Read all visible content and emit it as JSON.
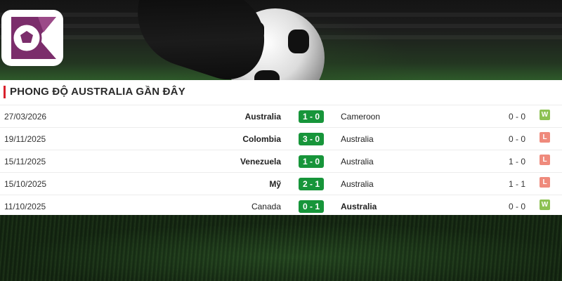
{
  "header": {
    "title": "PHONG ĐỘ AUSTRALIA GẦN ĐÂY"
  },
  "colors": {
    "score_bg": "#17953a",
    "win": "#8cc152",
    "loss": "#ef8a7c",
    "accent": "#d9212c"
  },
  "matches": [
    {
      "date": "27/03/2026",
      "home": "Australia",
      "score": "1 - 0",
      "away": "Cameroon",
      "half_time": "0 - 0",
      "result": "W"
    },
    {
      "date": "19/11/2025",
      "home": "Colombia",
      "score": "3 - 0",
      "away": "Australia",
      "half_time": "0 - 0",
      "result": "L"
    },
    {
      "date": "15/11/2025",
      "home": "Venezuela",
      "score": "1 - 0",
      "away": "Australia",
      "half_time": "1 - 0",
      "result": "L"
    },
    {
      "date": "15/10/2025",
      "home": "Mỹ",
      "score": "2 - 1",
      "away": "Australia",
      "half_time": "1 - 1",
      "result": "L"
    },
    {
      "date": "11/10/2025",
      "home": "Canada",
      "score": "0 - 1",
      "away": "Australia",
      "half_time": "0 - 0",
      "result": "W"
    }
  ]
}
